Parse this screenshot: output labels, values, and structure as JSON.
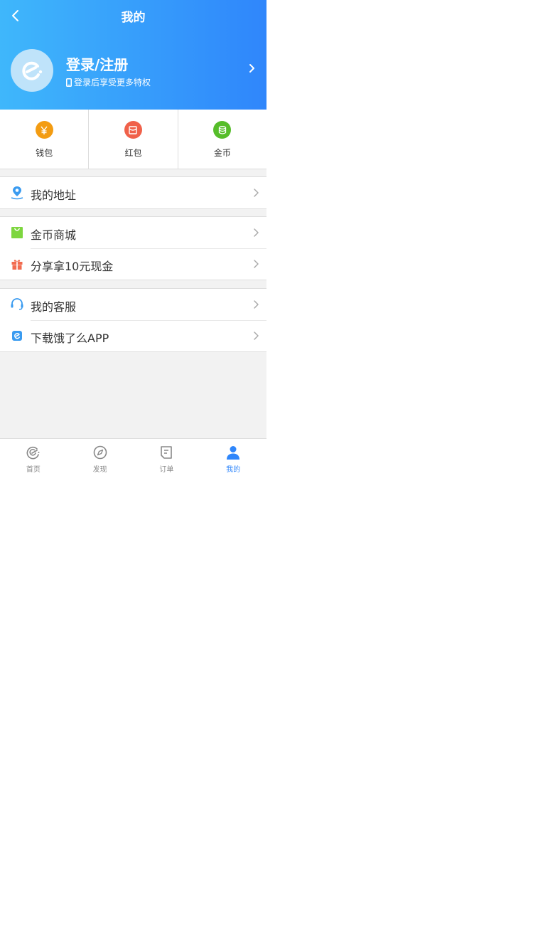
{
  "header": {
    "title": "我的",
    "login_title": "登录/注册",
    "login_subtitle": "登录后享受更多特权",
    "colors": {
      "gradient_start": "#3fb7fb",
      "gradient_end": "#2f86fb"
    }
  },
  "quick_actions": [
    {
      "label": "钱包",
      "icon": "wallet-icon",
      "color": "#f39c12"
    },
    {
      "label": "红包",
      "icon": "red-packet-icon",
      "color": "#f0614a"
    },
    {
      "label": "金币",
      "icon": "coin-icon",
      "color": "#56bd2a"
    }
  ],
  "menu_groups": [
    [
      {
        "label": "我的地址",
        "icon": "location-pin-icon"
      }
    ],
    [
      {
        "label": "金币商城",
        "icon": "shopping-bag-icon"
      },
      {
        "label": "分享拿10元现金",
        "icon": "gift-icon"
      }
    ],
    [
      {
        "label": "我的客服",
        "icon": "headset-icon"
      },
      {
        "label": "下载饿了么APP",
        "icon": "app-logo-icon"
      }
    ]
  ],
  "tabbar": {
    "items": [
      {
        "label": "首页",
        "icon": "eleme-logo-icon"
      },
      {
        "label": "发现",
        "icon": "compass-icon"
      },
      {
        "label": "订单",
        "icon": "order-list-icon"
      },
      {
        "label": "我的",
        "icon": "user-icon"
      }
    ],
    "active": "我的",
    "active_color": "#2f86fb"
  }
}
